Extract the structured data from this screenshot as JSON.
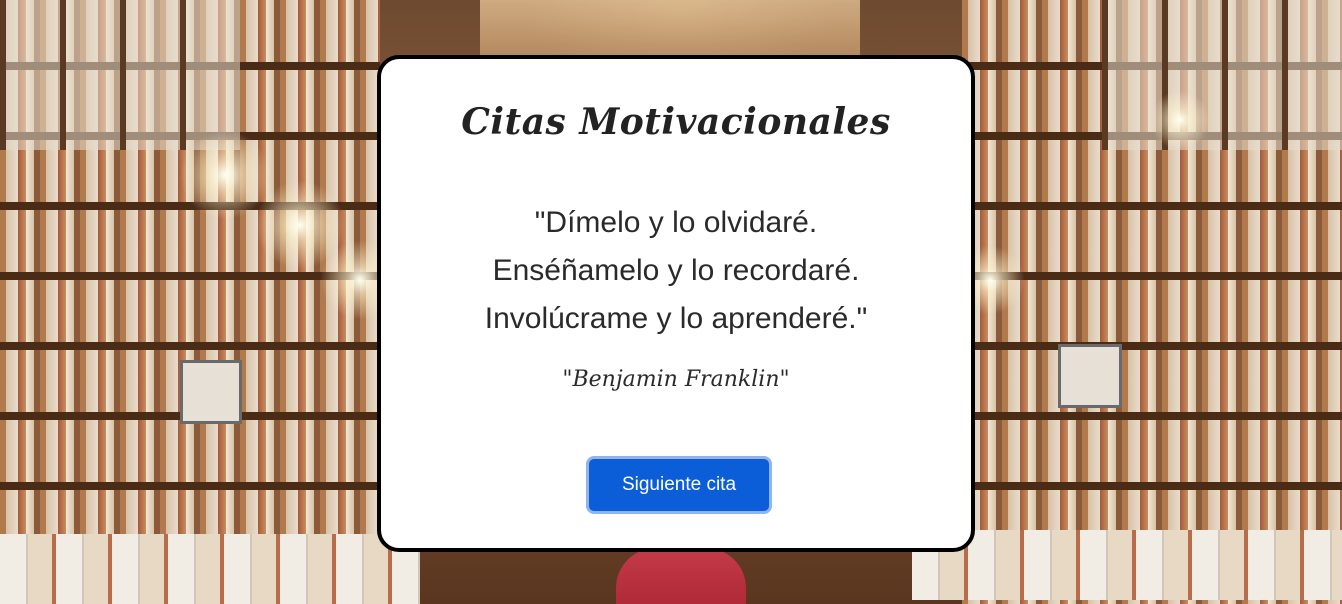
{
  "card": {
    "title": "Citas Motivacionales",
    "quote_lines": [
      "\"Dímelo y lo olvidaré.",
      "Enséñamelo y lo recordaré.",
      "Involúcrame y lo aprenderé.\""
    ],
    "author": "\"Benjamin Franklin\"",
    "next_button_label": "Siguiente cita"
  },
  "colors": {
    "button": "#0b5ed7",
    "card_border": "#000000",
    "card_background": "#ffffff"
  }
}
